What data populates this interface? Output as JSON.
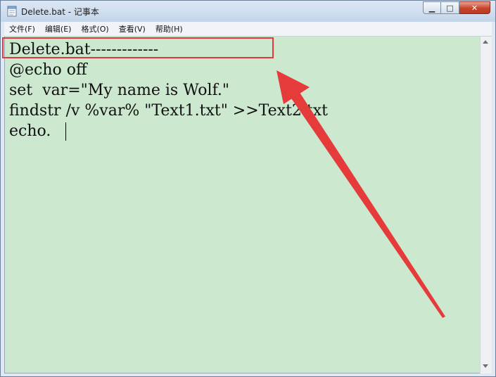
{
  "window": {
    "title": "Delete.bat - 记事本"
  },
  "window_controls": {
    "minimize": "▁",
    "maximize": "□",
    "close": "✕"
  },
  "menubar": {
    "items": [
      "文件(F)",
      "编辑(E)",
      "格式(O)",
      "查看(V)",
      "帮助(H)"
    ]
  },
  "editor": {
    "lines": [
      "Delete.bat-------------",
      "@echo off",
      "set  var=\"My name is Wolf.\"",
      "findstr /v %var% \"Text1.txt\" >>Text2.txt",
      "echo."
    ],
    "background": "#cce8cf"
  },
  "annotation": {
    "box_color": "#e03a3a",
    "arrow_color": "#e53b3b"
  }
}
